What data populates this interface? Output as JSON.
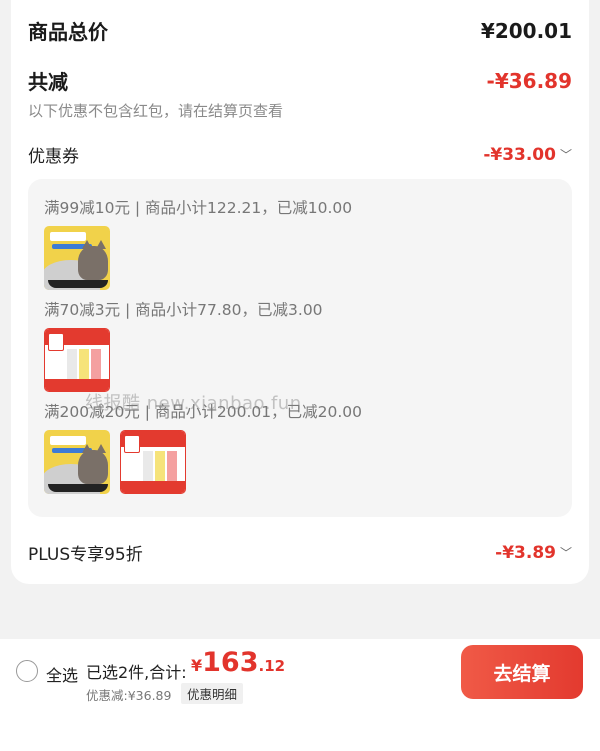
{
  "summary": {
    "total_label": "商品总价",
    "total_value": "¥200.01",
    "reduce_label": "共减",
    "reduce_value": "-¥36.89",
    "note": "以下优惠不包含红包，请在结算页查看",
    "coupon_label": "优惠券",
    "coupon_value": "-¥33.00",
    "plus_label": "PLUS专享95折",
    "plus_value": "-¥3.89"
  },
  "coupon_groups": [
    {
      "title": "满99减10元 | 商品小计122.21，已减10.00",
      "items": [
        "litter"
      ]
    },
    {
      "title": "满70减3元 | 商品小计77.80，已减3.00",
      "items": [
        "treat"
      ]
    },
    {
      "title": "满200减20元 | 商品小计200.01，已减20.00",
      "items": [
        "litter",
        "treat"
      ]
    }
  ],
  "watermark": "线报酷 new.xianbao.fun",
  "footer": {
    "select_all": "全选",
    "selected_text": "已选2件,合计:",
    "currency": "¥",
    "total_int": "163",
    "total_dec": ".12",
    "discount_text": "优惠减:¥36.89",
    "detail_button": "优惠明细",
    "checkout_button": "去结算"
  },
  "colors": {
    "accent": "#e2342c",
    "background": "#f2f2f2"
  }
}
